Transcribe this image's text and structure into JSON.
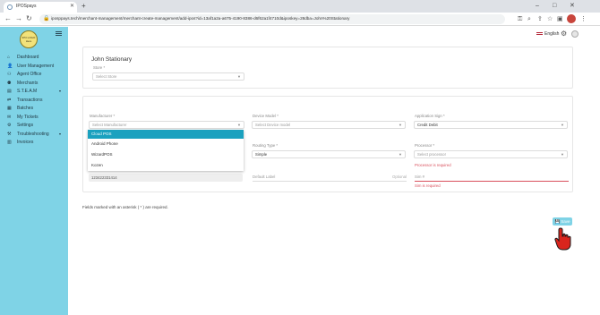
{
  "browser": {
    "tab_title": "IPOSpays",
    "url": "iposppays.tech/merchant-management/merchant-create-management/add-ipos?id=13af1a2a-a675-4190-8386-d6f62a1f4710d&iposkey=28dba=John%20Stationary",
    "colors": {
      "avatar": "#c8453c"
    }
  },
  "sidebar": {
    "logo_text": "IPO LOGO Here",
    "items": [
      {
        "label": "Dashboard",
        "icon": "home-icon"
      },
      {
        "label": "User Management",
        "icon": "user-icon"
      },
      {
        "label": "Agent Office",
        "icon": "agent-icon"
      },
      {
        "label": "Merchants",
        "icon": "merchants-icon"
      },
      {
        "label": "S.T.E.A.M",
        "icon": "steam-icon",
        "has_chevron": true
      },
      {
        "label": "Transactions",
        "icon": "transactions-icon"
      },
      {
        "label": "Batches",
        "icon": "batches-icon"
      },
      {
        "label": "My Tickets",
        "icon": "ticket-icon"
      },
      {
        "label": "Settings",
        "icon": "gear-icon"
      },
      {
        "label": "Troubleshooting",
        "icon": "wrench-icon",
        "has_chevron": true
      },
      {
        "label": "Invoices",
        "icon": "invoice-icon"
      }
    ],
    "colors": {
      "background": "#7fd3e6"
    }
  },
  "header": {
    "language": "English"
  },
  "store_card": {
    "merchant_name": "John Stationary",
    "store_label": "Store *",
    "store_placeholder": "Select Store"
  },
  "device_form": {
    "manufacturer_label": "Manufacturer *",
    "manufacturer_placeholder": "Select Manufacturer",
    "device_model_label": "Device Model *",
    "device_model_placeholder": "Select Device model",
    "application_sign_label": "Application Sign *",
    "application_sign_value": "Credit Debit",
    "routing_type_label": "Routing Type *",
    "routing_type_value": "Simple",
    "processor_label": "Processor *",
    "processor_placeholder": "Select processor",
    "processor_error": "Processor is required",
    "serial_value": "123422331414",
    "default_label_placeholder": "Default Label",
    "optional_text": "Optional",
    "sim_placeholder": "Sim #",
    "sim_error": "Sim is required"
  },
  "manufacturer_dropdown": {
    "options": [
      "Cloud POS",
      "Android Phone",
      "WizardPOS",
      "Kozen"
    ],
    "selected_index": 0,
    "colors": {
      "highlight": "#1aa1bf"
    }
  },
  "footer": {
    "required_note": "Fields marked with an asterisk ( * ) are required.",
    "save_label": "Save"
  }
}
